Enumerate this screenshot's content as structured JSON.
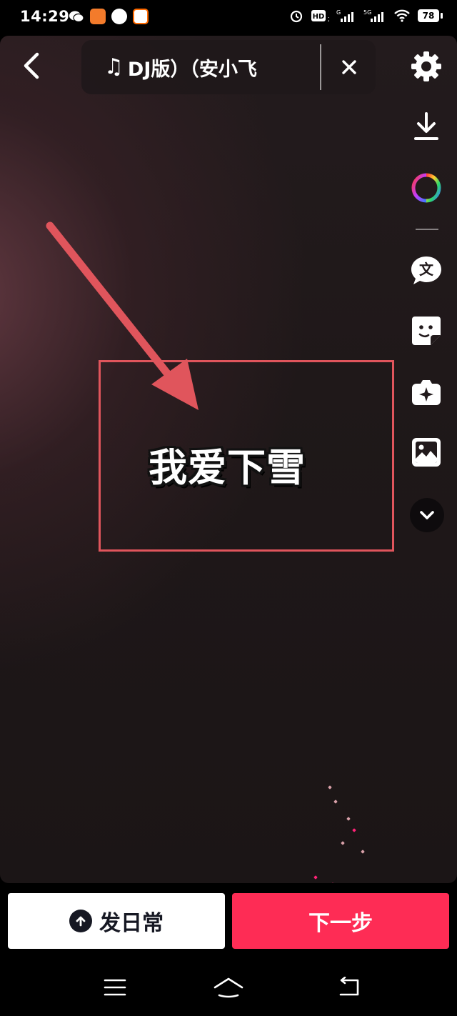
{
  "status_bar": {
    "time": "14:29",
    "battery": "78",
    "network_label": "5G",
    "hd_label": "HD"
  },
  "editor": {
    "music_title": "DJ版）（安小飞",
    "text_sticker": "我爱下雪"
  },
  "toolbar": {
    "tools": [
      "gear-icon",
      "download-icon",
      "color-wheel-icon",
      "text-bubble-icon",
      "sticker-icon",
      "effects-icon",
      "image-icon",
      "chevron-down-icon"
    ]
  },
  "actions": {
    "daily_label": "发日常",
    "next_label": "下一步"
  },
  "colors": {
    "accent": "#fe2c55",
    "annotation": "#e0555c",
    "canvas": "#1f1819"
  }
}
